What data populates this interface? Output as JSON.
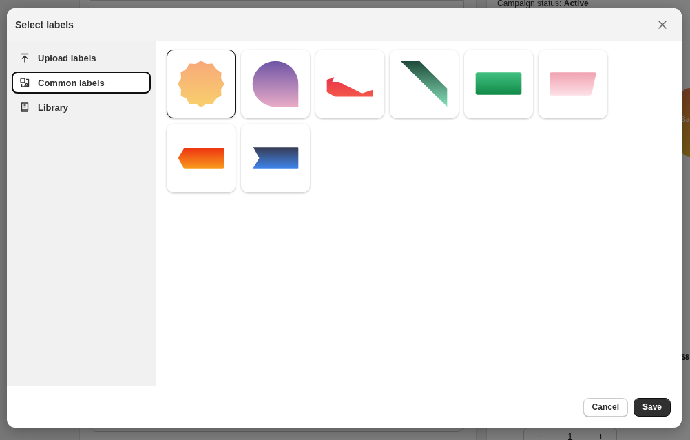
{
  "background": {
    "campaign_label": "Campaign status: ",
    "campaign_value": "Active",
    "badge": "Sa",
    "price": "$8",
    "quantity": {
      "minus": "−",
      "value": "1",
      "plus": "+"
    }
  },
  "dialog": {
    "title": "Select labels",
    "nav": [
      {
        "label": "Upload labels",
        "kind": "upload",
        "selected": false
      },
      {
        "label": "Common labels",
        "kind": "shapes",
        "selected": true
      },
      {
        "label": "Library",
        "kind": "book",
        "selected": false
      }
    ],
    "labels": [
      {
        "kind": "burst",
        "selected": true
      },
      {
        "kind": "drop",
        "selected": false
      },
      {
        "kind": "ribbon",
        "selected": false
      },
      {
        "kind": "sash",
        "selected": false
      },
      {
        "kind": "rectangle",
        "selected": false
      },
      {
        "kind": "trapezoid",
        "selected": false
      },
      {
        "kind": "tag",
        "selected": false
      },
      {
        "kind": "banner",
        "selected": false
      }
    ],
    "buttons": {
      "cancel": "Cancel",
      "save": "Save"
    }
  }
}
